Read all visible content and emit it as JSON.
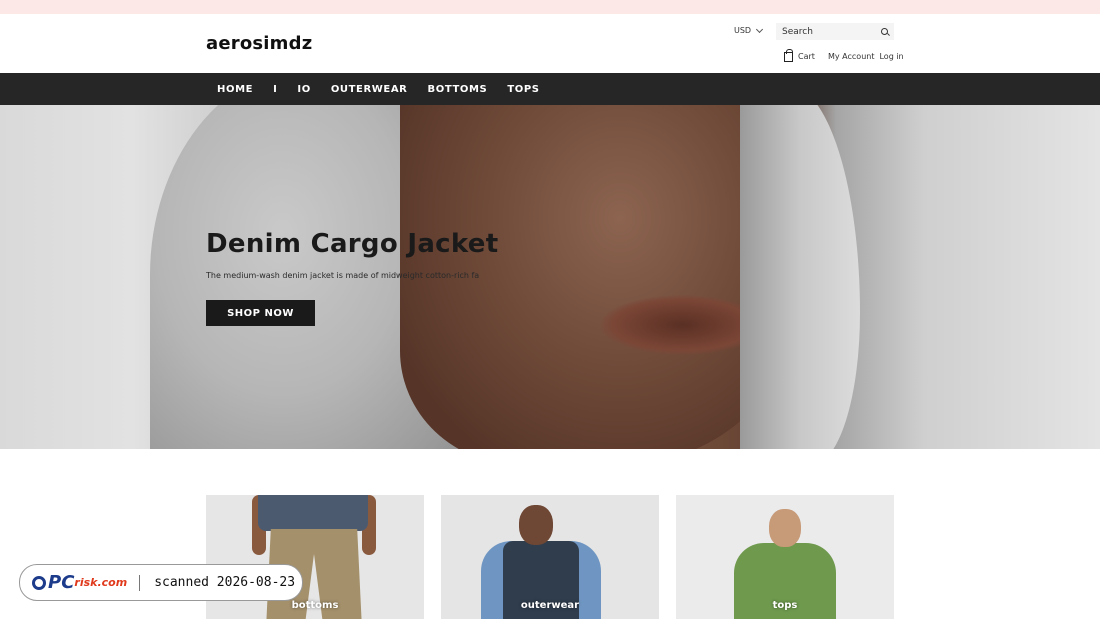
{
  "store": {
    "name": "aerosimdz"
  },
  "header": {
    "currency": "USD",
    "search_placeholder": "Search",
    "cart_label": "Cart",
    "my_account": "My Account",
    "log_in": "Log in"
  },
  "nav": {
    "items": [
      "HOME",
      "I",
      "IO",
      "OUTERWEAR",
      "BOTTOMS",
      "TOPS"
    ]
  },
  "hero": {
    "title": "Denim Cargo Jacket",
    "description": "The medium-wash denim jacket is made of midweight cotton-rich fa",
    "button": "SHOP NOW"
  },
  "collections": [
    {
      "label": "bottoms"
    },
    {
      "label": "outerwear"
    },
    {
      "label": "tops"
    }
  ],
  "badge": {
    "brand": "PC",
    "brand_suffix": "risk.com",
    "scan_text": "scanned 2026-08-23"
  },
  "colors": {
    "nav_bg": "#262626",
    "topbar": "#fde8e8",
    "button_bg": "#1a1a1a"
  }
}
